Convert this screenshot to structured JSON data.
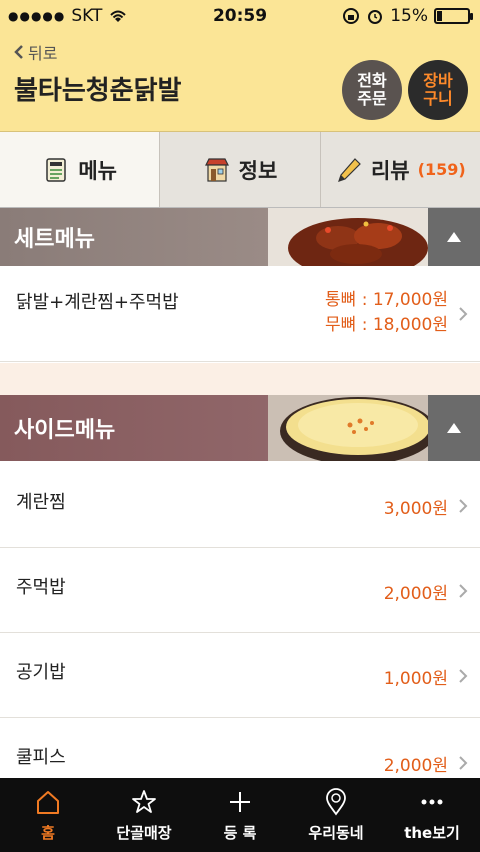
{
  "status": {
    "carrier": "SKT",
    "time": "20:59",
    "battery": "15%",
    "battery_level": 0.15
  },
  "header": {
    "back_label": "뒤로",
    "title": "불타는청춘닭발",
    "phone_button": {
      "line1": "전화",
      "line2": "주문"
    },
    "cart_button": {
      "line1": "장바",
      "line2": "구니"
    }
  },
  "tabs": [
    {
      "label": "메뉴",
      "icon": "menu-icon"
    },
    {
      "label": "정보",
      "icon": "shop-icon"
    },
    {
      "label": "리뷰",
      "count": "(159)",
      "icon": "pencil-icon"
    }
  ],
  "sections": [
    {
      "title": "세트메뉴",
      "items": [
        {
          "name": "닭발+계란찜+주먹밥",
          "prices": [
            "통뼈 : 17,000원",
            "무뼈 : 18,000원"
          ]
        }
      ]
    },
    {
      "title": "사이드메뉴",
      "items": [
        {
          "name": "계란찜",
          "prices": [
            "3,000원"
          ]
        },
        {
          "name": "주먹밥",
          "prices": [
            "2,000원"
          ]
        },
        {
          "name": "공기밥",
          "prices": [
            "1,000원"
          ]
        },
        {
          "name": "쿨피스",
          "prices": [
            "2,000원"
          ]
        }
      ]
    }
  ],
  "bottom_nav": [
    {
      "label": "홈",
      "icon": "home-icon",
      "active": true
    },
    {
      "label": "단골매장",
      "icon": "star-icon"
    },
    {
      "label": "등 록",
      "icon": "plus-icon"
    },
    {
      "label": "우리동네",
      "icon": "location-pin-icon"
    },
    {
      "label": "the보기",
      "icon": "more-icon"
    }
  ],
  "colors": {
    "header_bg": "#fbe596",
    "accent": "#f0631a",
    "price": "#e25e1a",
    "nav_bg": "#0e0e0e"
  }
}
